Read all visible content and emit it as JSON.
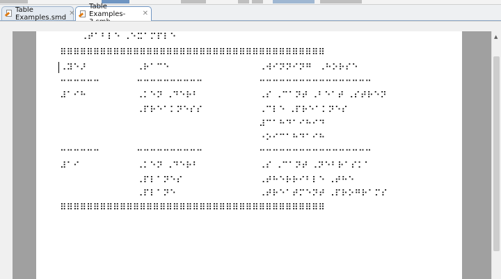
{
  "tabs": [
    {
      "label": "Table Examples.smd",
      "active": false
    },
    {
      "label": "Table Examples-3.smb",
      "active": true
    }
  ],
  "document": {
    "lines": [
      {
        "text": "⠠⠞⠁⠃⠇⠑ ⠠⠑⠭⠁⠍⠏⠇⠑",
        "col": 1
      },
      {
        "text": "⠿⠿⠿⠿⠿⠿⠿⠿⠿⠿⠿⠿⠿⠿⠿⠿⠿⠿⠿⠿⠿⠿⠿⠿⠿⠿⠿⠿⠿⠿⠿⠿⠿⠿⠿⠿⠿⠿⠿⠿",
        "col": 0
      },
      {
        "cells": [
          "⠠⠽⠑⠜",
          "⠠⠗⠁⠉⠑",
          "⠠⠺⠊⠝⠝⠊⠝⠛⠀⠠⠓⠕⠗⠎⠑"
        ]
      },
      {
        "cells": [
          "⠒⠒⠒⠒⠒⠒",
          "⠒⠒⠒⠒⠒⠒⠒⠒⠒⠒",
          "⠒⠒⠒⠒⠒⠒⠒⠒⠒⠒⠒⠒⠒⠒⠒⠒⠒"
        ]
      },
      {
        "cells": [
          "⠼⠁⠊⠓",
          "⠠⠅⠑⠝ ⠠⠙⠑⠗⠃",
          "⠠⠎ ⠠⠉⠁⠝⠞ ⠠⠃⠑⠁⠞ ⠠⠎⠞⠗⠑⠝"
        ]
      },
      {
        "cells": [
          "",
          "⠠⠏⠗⠑⠁⠅⠝⠑⠎⠎",
          "⠠⠉⠇⠑ ⠠⠏⠗⠑⠁⠅⠝⠑⠎"
        ]
      },
      {
        "cells": [
          "",
          "",
          "⠼⠉⠁⠓⠙⠁⠊⠓⠊⠙"
        ]
      },
      {
        "cells": [
          "",
          "",
          "⠐⠕⠊⠉⠁⠓⠙⠁⠊⠓"
        ]
      },
      {
        "cells": [
          "⠒⠒⠒⠒⠒⠒",
          "⠒⠒⠒⠒⠒⠒⠒⠒⠒⠒",
          "⠒⠒⠒⠒⠒⠒⠒⠒⠒⠒⠒⠒⠒⠒⠒⠒⠒"
        ]
      },
      {
        "cells": [
          "⠼⠁⠊",
          "⠠⠅⠑⠝ ⠠⠙⠑⠗⠃",
          "⠠⠎ ⠠⠉⠁⠝⠞ ⠠⠝⠑⠃⠗⠁⠎⠅⠁"
        ]
      },
      {
        "cells": [
          "",
          "⠠⠏⠇⠁⠝⠑⠎",
          "⠠⠞⠓⠑⠗⠗⠊⠃⠇⠑ ⠠⠞⠓⠑"
        ]
      },
      {
        "cells": [
          "",
          "⠠⠏⠇⠁⠝⠑",
          "⠠⠞⠗⠑⠁⠞⠍⠑⠝⠞ ⠠⠏⠗⠕⠛⠗⠁⠍⠎"
        ]
      },
      {
        "text": "⠿⠿⠿⠿⠿⠿⠿⠿⠿⠿⠿⠿⠿⠿⠿⠿⠿⠿⠿⠿⠿⠿⠿⠿⠿⠿⠿⠿⠿⠿⠿⠿⠿⠿⠿⠿⠿⠿⠿⠿",
        "col": 0
      }
    ]
  }
}
